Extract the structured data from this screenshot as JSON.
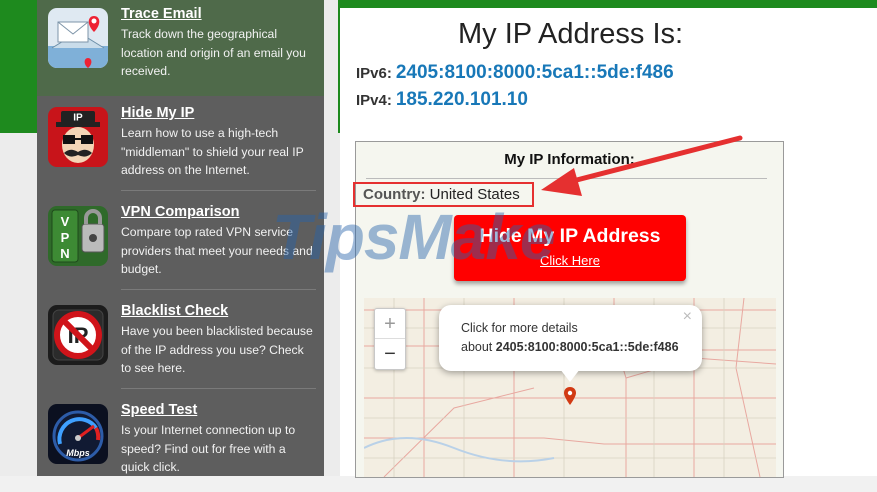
{
  "sidebar": {
    "items": [
      {
        "title": "Trace Email",
        "desc": "Track down the geographical location and origin of an email you received.",
        "icon": "trace-email-icon"
      },
      {
        "title": "Hide My IP",
        "desc": "Learn how to use a high-tech \"middleman\" to shield your real IP address on the Internet.",
        "icon": "hide-my-ip-icon"
      },
      {
        "title": "VPN Comparison",
        "desc": "Compare top rated VPN service providers that meet your needs and budget.",
        "icon": "vpn-icon"
      },
      {
        "title": "Blacklist Check",
        "desc": "Have you been blacklisted because of the IP address you use? Check to see here.",
        "icon": "blacklist-icon"
      },
      {
        "title": "Speed Test",
        "desc": "Is your Internet connection up to speed? Find out for free with a quick click.",
        "icon": "speedometer-icon"
      }
    ]
  },
  "main": {
    "heading": "My IP Address Is:",
    "ipv6_label": "IPv6:",
    "ipv6_value": "2405:8100:8000:5ca1::5de:f486",
    "ipv4_label": "IPv4:",
    "ipv4_value": "185.220.101.10"
  },
  "info": {
    "title": "My IP Information:",
    "country_label": "Country:",
    "country_value": "United States",
    "button_title": "Hide My IP Address",
    "button_link": "Click Here"
  },
  "map": {
    "zoom_in": "+",
    "zoom_out": "−",
    "popup_line1": "Click for more details",
    "popup_about": "about",
    "popup_ip": "2405:8100:8000:5ca1::5de:f486",
    "popup_close": "×"
  },
  "watermark": "TipsMake",
  "colors": {
    "accent_green": "#1e8a1e",
    "link_blue": "#1878b8",
    "button_red": "#ff0000",
    "highlight_red": "#e53030"
  }
}
